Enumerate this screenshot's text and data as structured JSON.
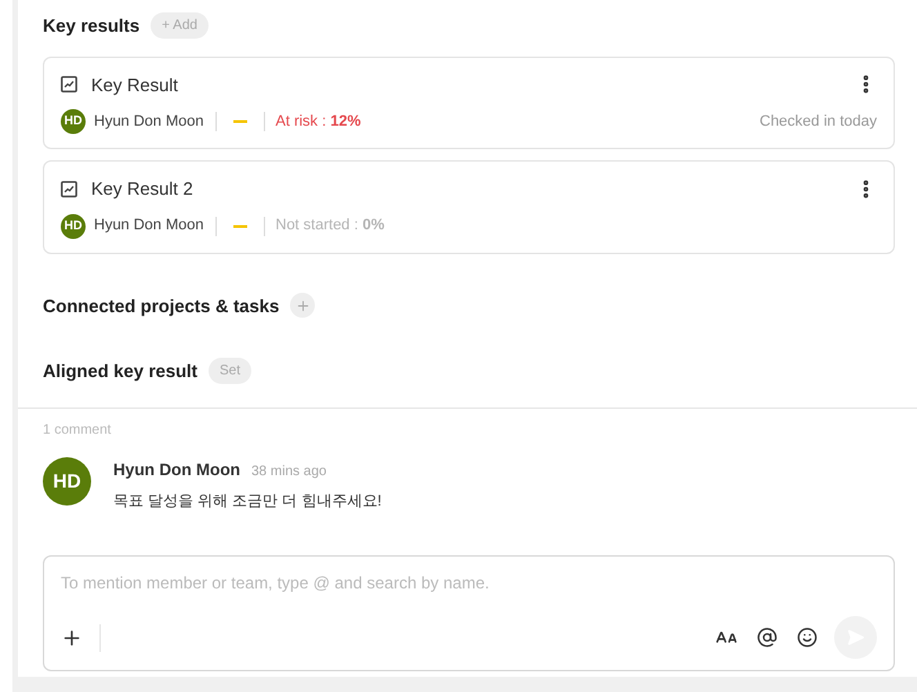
{
  "key_results_section": {
    "title": "Key results",
    "add_label": "+ Add"
  },
  "key_results": [
    {
      "title": "Key Result",
      "owner": {
        "initials": "HD",
        "name": "Hyun Don Moon"
      },
      "status": {
        "kind": "at_risk",
        "label": "At risk : ",
        "percent": "12%"
      },
      "checked_in": "Checked in today"
    },
    {
      "title": "Key Result 2",
      "owner": {
        "initials": "HD",
        "name": "Hyun Don Moon"
      },
      "status": {
        "kind": "not_started",
        "label": "Not started : ",
        "percent": "0%"
      }
    }
  ],
  "connected": {
    "title": "Connected projects & tasks"
  },
  "aligned": {
    "title": "Aligned key result",
    "set_label": "Set"
  },
  "comments_count": "1 comment",
  "comments": [
    {
      "initials": "HD",
      "author": "Hyun Don Moon",
      "time": "38 mins ago",
      "text": "목표 달성을 위해 조금만 더 힘내주세요!"
    }
  ],
  "composer": {
    "placeholder": "To mention member or team, type @ and search by name."
  }
}
